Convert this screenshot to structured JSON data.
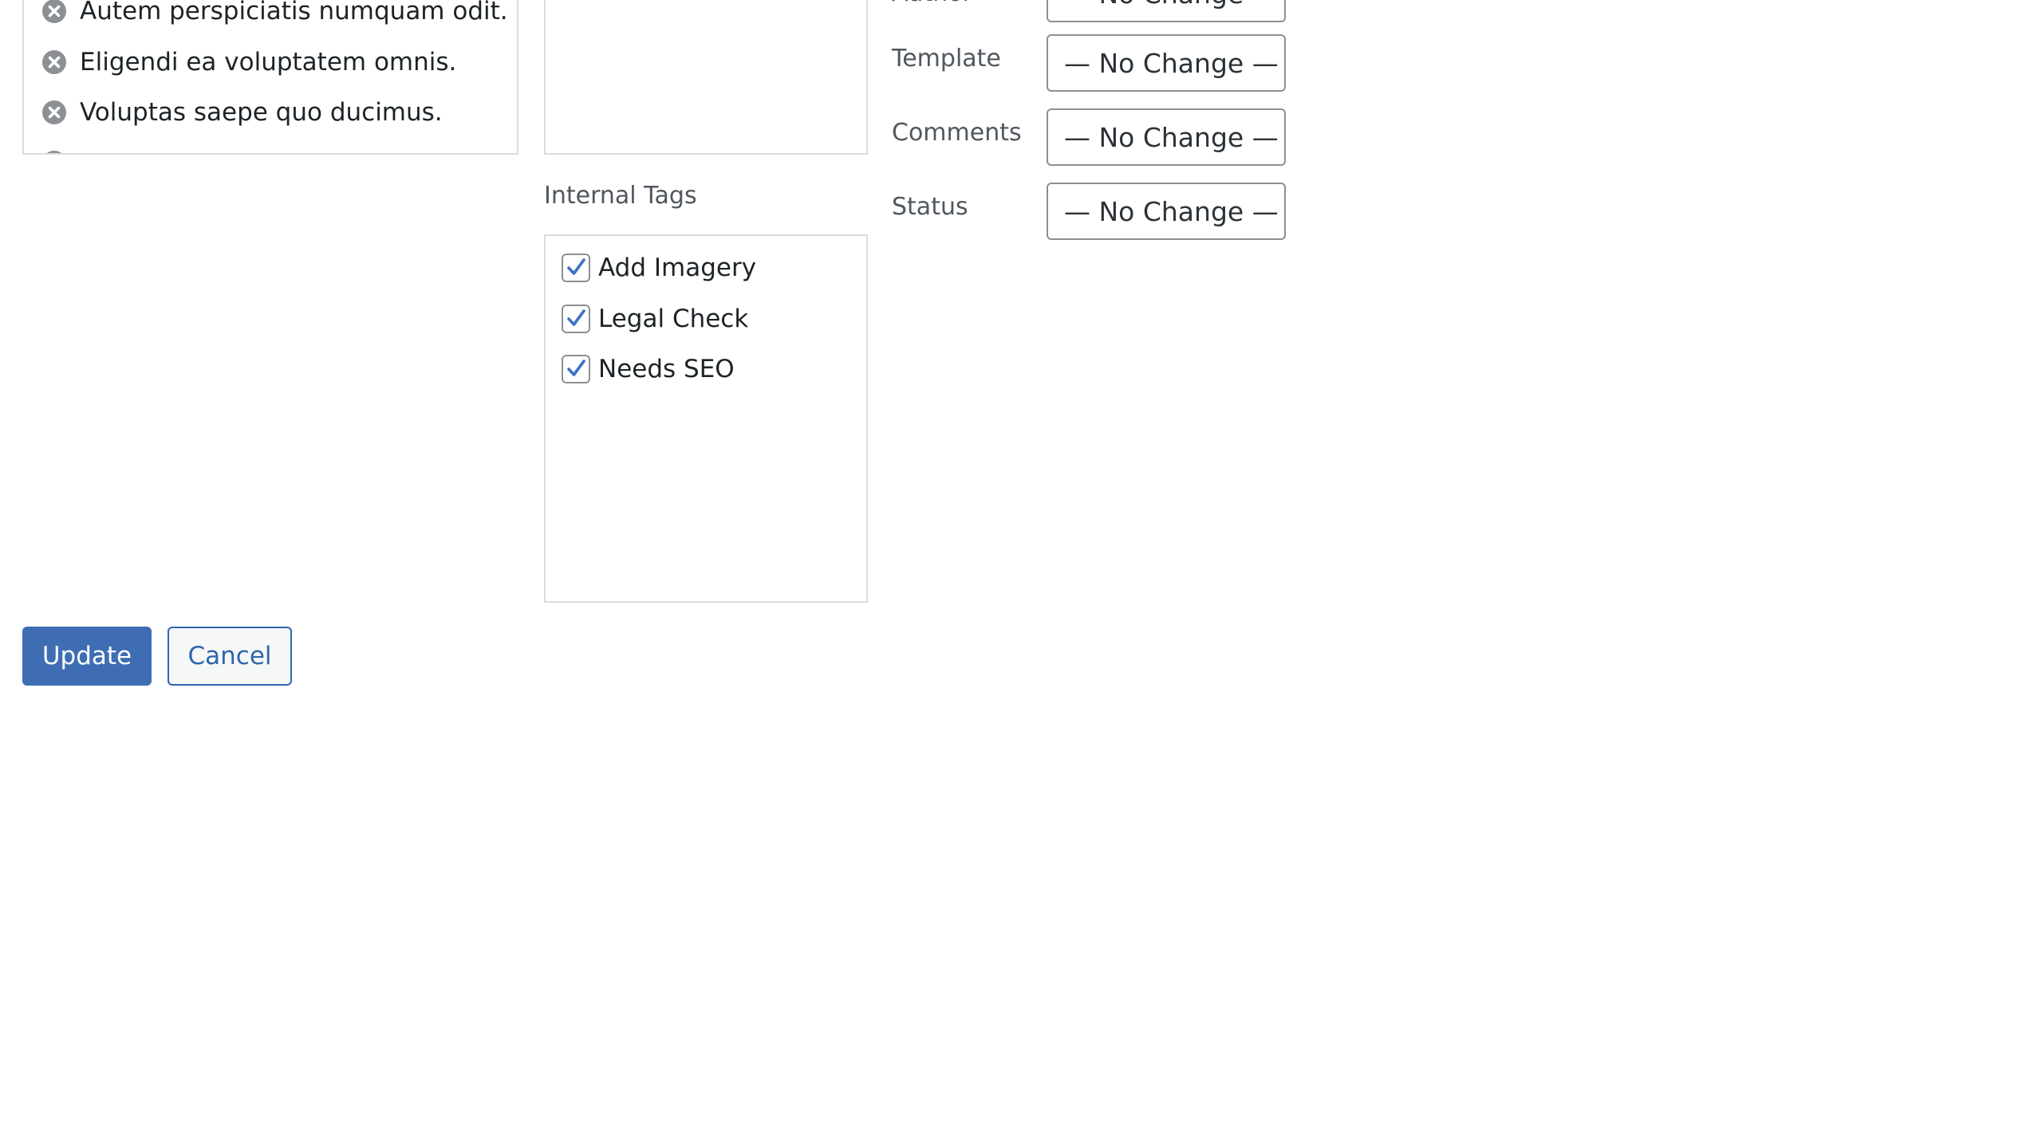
{
  "posts": {
    "items": [
      {
        "label": "Autem perspiciatis numquam odit."
      },
      {
        "label": "Eligendi ea voluptatem omnis."
      },
      {
        "label": "Voluptas saepe quo ducimus."
      }
    ]
  },
  "internal_tags": {
    "heading": "Internal Tags",
    "items": [
      {
        "label": "Add Imagery",
        "checked": true
      },
      {
        "label": "Legal Check",
        "checked": true
      },
      {
        "label": "Needs SEO",
        "checked": true
      }
    ]
  },
  "fields": {
    "author": {
      "label": "Author",
      "value": "— No Change —"
    },
    "template": {
      "label": "Template",
      "value": "— No Change —"
    },
    "comments": {
      "label": "Comments",
      "value": "— No Change —"
    },
    "status": {
      "label": "Status",
      "value": "— No Change —"
    }
  },
  "actions": {
    "update_label": "Update",
    "cancel_label": "Cancel"
  },
  "colors": {
    "primary": "#3e6db3",
    "link": "#2f66ad",
    "checkmark": "#3f72c2",
    "border": "#dcdcde"
  }
}
